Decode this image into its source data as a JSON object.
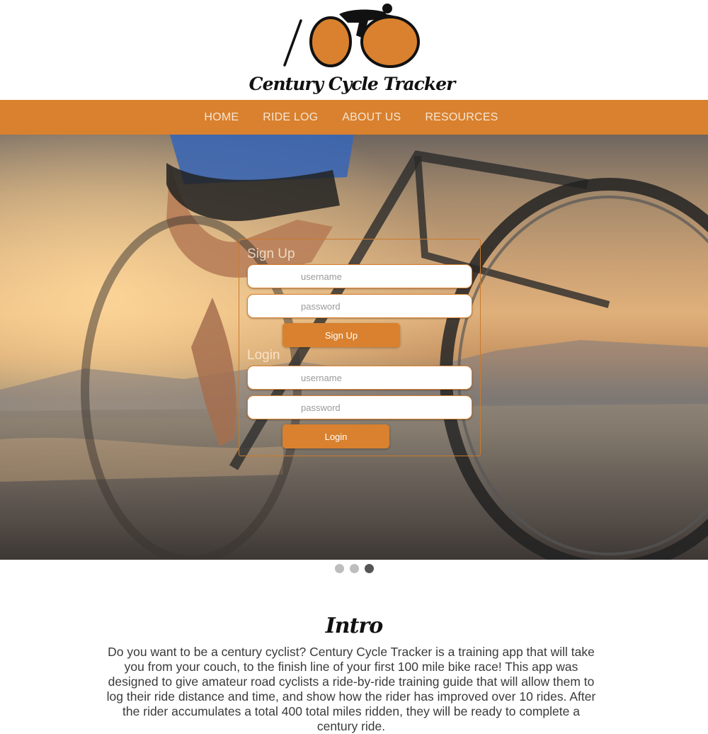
{
  "header": {
    "brand_title": "Century Cycle Tracker",
    "logo_icon": "cyclist-logo-icon"
  },
  "nav": {
    "items": [
      {
        "label": "HOME"
      },
      {
        "label": "RIDE LOG"
      },
      {
        "label": "ABOUT US"
      },
      {
        "label": "RESOURCES"
      }
    ]
  },
  "hero": {
    "image": "cyclist-road-bike-sunset",
    "signup": {
      "heading": "Sign Up",
      "username_placeholder": "username",
      "password_placeholder": "password",
      "button_label": "Sign Up"
    },
    "login": {
      "heading": "Login",
      "username_placeholder": "username",
      "password_placeholder": "password",
      "button_label": "Login"
    }
  },
  "carousel": {
    "active_index": 3,
    "slide_count": 3
  },
  "intro": {
    "title": "Intro",
    "text": "Do you want to be a century cyclist? Century Cycle Tracker is a training app that will take you from your couch, to the finish line of your first 100 mile bike race! This app was designed to give amateur road cyclists a ride-by-ride training guide that will allow them to log their ride distance and time, and show how the rider has improved over 10 rides. After the rider accumulates a total 400 total miles ridden, they will be ready to complete a century ride."
  },
  "colors": {
    "accent": "#d9812e",
    "nav_text": "#f7e5d3",
    "dot_inactive": "#bdbdbd",
    "dot_active": "#555555"
  }
}
